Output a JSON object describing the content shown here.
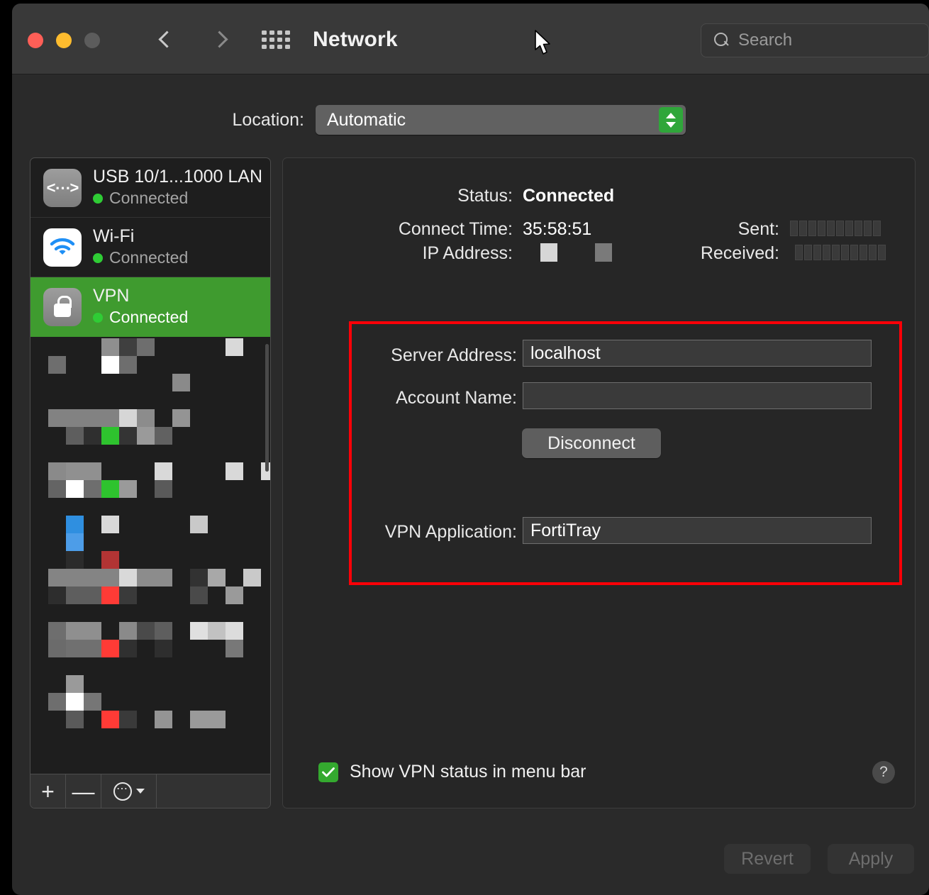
{
  "window": {
    "title": "Network",
    "traffic_lights": [
      "close-red",
      "minimize-yellow",
      "zoom-gray"
    ],
    "nav": {
      "back_icon": "chevron-left-icon",
      "forward_icon": "chevron-right-icon",
      "grid_icon": "show-all-grid-icon"
    },
    "search": {
      "placeholder": "Search",
      "icon": "search-icon"
    }
  },
  "location": {
    "label": "Location:",
    "selected": "Automatic",
    "stepper_icon": "chevron-up-down-icon"
  },
  "sidebar": {
    "services": [
      {
        "name": "USB 10/1...1000 LAN",
        "status": "Connected",
        "icon": "ethernet-icon",
        "selected": false
      },
      {
        "name": "Wi-Fi",
        "status": "Connected",
        "icon": "wifi-icon",
        "selected": false
      },
      {
        "name": "VPN",
        "status": "Connected",
        "icon": "lock-icon",
        "selected": true
      }
    ],
    "redacted_note": "",
    "toolbar": {
      "add_label": "+",
      "remove_label": "—",
      "actions_icon": "ellipsis-circle-icon",
      "actions_chevron_icon": "chevron-down-icon"
    }
  },
  "details": {
    "status_label": "Status:",
    "status_value": "Connected",
    "connect_time_label": "Connect Time:",
    "connect_time_value": "35:58:51",
    "ip_address_label": "IP Address:",
    "ip_address_value": "",
    "sent_label": "Sent:",
    "sent_value": "",
    "received_label": "Received:",
    "received_value": "",
    "server_address_label": "Server Address:",
    "server_address_value": "localhost",
    "account_name_label": "Account Name:",
    "account_name_value": "",
    "disconnect_label": "Disconnect",
    "vpn_application_label": "VPN Application:",
    "vpn_application_value": "FortiTray",
    "show_status_label": "Show VPN status in menu bar",
    "show_status_checked": true,
    "help_label": "?"
  },
  "footer": {
    "revert_label": "Revert",
    "apply_label": "Apply"
  },
  "colors": {
    "selection_green": "#3f9b2f",
    "status_dot_green": "#2fcc35",
    "highlight_red": "#fb0007",
    "accent_checkbox": "#34a92f"
  }
}
